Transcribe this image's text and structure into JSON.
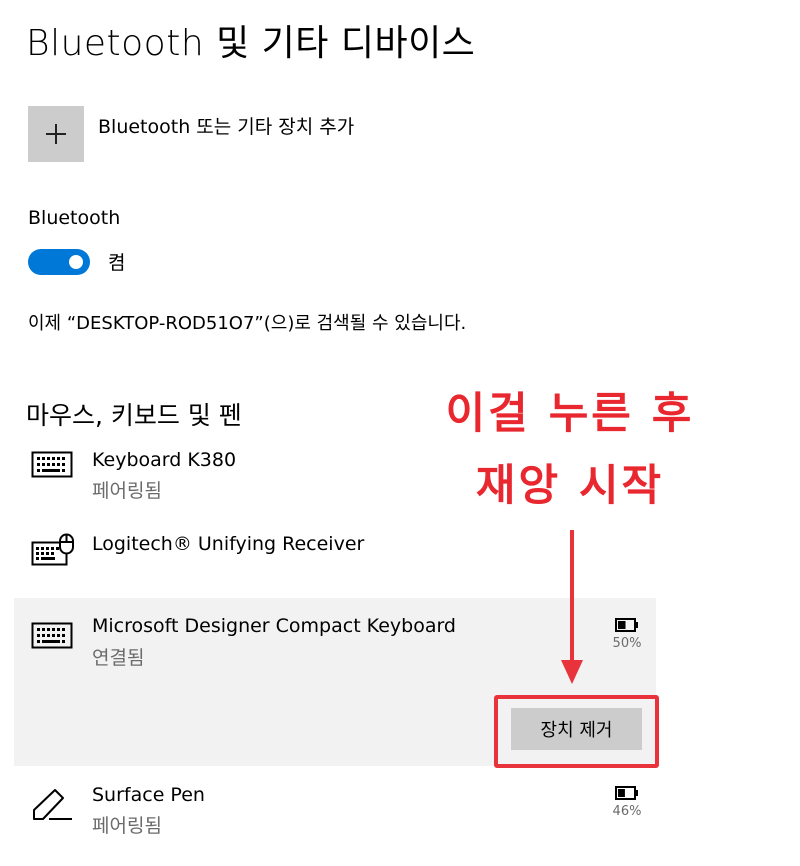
{
  "page_title": "Bluetooth 및 기타 디바이스",
  "add_device": {
    "label": "Bluetooth 또는 기타 장치 추가",
    "icon": "plus-icon"
  },
  "bluetooth": {
    "heading": "Bluetooth",
    "toggle_state": "켬",
    "toggle_on": true,
    "toggle_color": "#0078d7"
  },
  "discoverable_text": "이제 “DESKTOP-ROD51O7”(으)로 검색될 수 있습니다.",
  "section_heading": "마우스, 키보드 및 펜",
  "devices": [
    {
      "name": "Keyboard K380",
      "status": "페어링됨",
      "icon": "keyboard-icon"
    },
    {
      "name": "Logitech® Unifying Receiver",
      "status": "",
      "icon": "keyboard-mouse-icon"
    },
    {
      "name": "Microsoft Designer Compact Keyboard",
      "status": "연결됨",
      "icon": "keyboard-icon",
      "battery": "50%",
      "battery_fill": 0.5,
      "selected": true,
      "action_label": "장치 제거"
    },
    {
      "name": "Surface Pen",
      "status": "페어링됨",
      "icon": "pen-icon",
      "battery": "46%",
      "battery_fill": 0.46
    }
  ],
  "annotation": {
    "line1": "이걸 누른 후",
    "line2": "재앙 시작",
    "color": "#e8323c"
  }
}
